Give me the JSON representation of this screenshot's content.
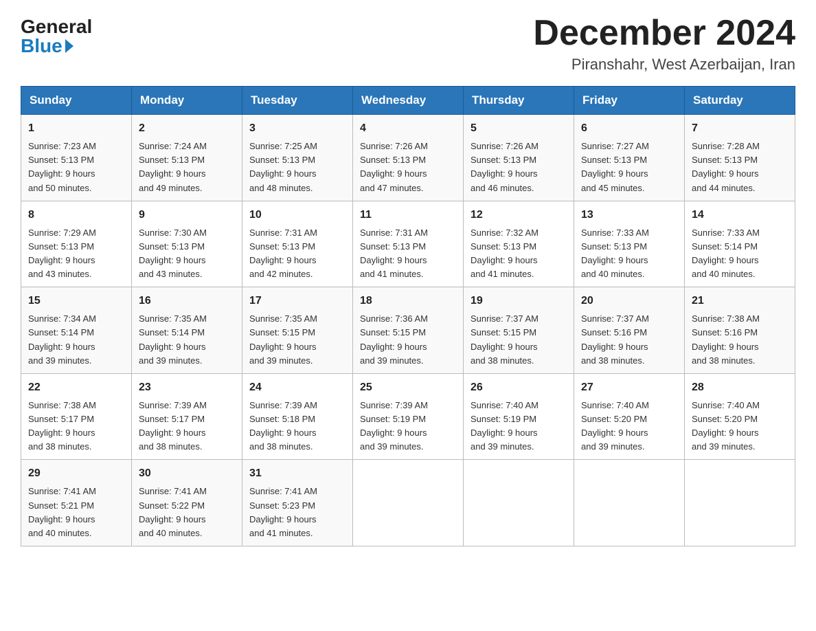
{
  "header": {
    "logo_general": "General",
    "logo_blue": "Blue",
    "month_title": "December 2024",
    "location": "Piranshahr, West Azerbaijan, Iran"
  },
  "weekdays": [
    "Sunday",
    "Monday",
    "Tuesday",
    "Wednesday",
    "Thursday",
    "Friday",
    "Saturday"
  ],
  "weeks": [
    [
      {
        "day": "1",
        "sunrise": "7:23 AM",
        "sunset": "5:13 PM",
        "daylight": "9 hours and 50 minutes."
      },
      {
        "day": "2",
        "sunrise": "7:24 AM",
        "sunset": "5:13 PM",
        "daylight": "9 hours and 49 minutes."
      },
      {
        "day": "3",
        "sunrise": "7:25 AM",
        "sunset": "5:13 PM",
        "daylight": "9 hours and 48 minutes."
      },
      {
        "day": "4",
        "sunrise": "7:26 AM",
        "sunset": "5:13 PM",
        "daylight": "9 hours and 47 minutes."
      },
      {
        "day": "5",
        "sunrise": "7:26 AM",
        "sunset": "5:13 PM",
        "daylight": "9 hours and 46 minutes."
      },
      {
        "day": "6",
        "sunrise": "7:27 AM",
        "sunset": "5:13 PM",
        "daylight": "9 hours and 45 minutes."
      },
      {
        "day": "7",
        "sunrise": "7:28 AM",
        "sunset": "5:13 PM",
        "daylight": "9 hours and 44 minutes."
      }
    ],
    [
      {
        "day": "8",
        "sunrise": "7:29 AM",
        "sunset": "5:13 PM",
        "daylight": "9 hours and 43 minutes."
      },
      {
        "day": "9",
        "sunrise": "7:30 AM",
        "sunset": "5:13 PM",
        "daylight": "9 hours and 43 minutes."
      },
      {
        "day": "10",
        "sunrise": "7:31 AM",
        "sunset": "5:13 PM",
        "daylight": "9 hours and 42 minutes."
      },
      {
        "day": "11",
        "sunrise": "7:31 AM",
        "sunset": "5:13 PM",
        "daylight": "9 hours and 41 minutes."
      },
      {
        "day": "12",
        "sunrise": "7:32 AM",
        "sunset": "5:13 PM",
        "daylight": "9 hours and 41 minutes."
      },
      {
        "day": "13",
        "sunrise": "7:33 AM",
        "sunset": "5:13 PM",
        "daylight": "9 hours and 40 minutes."
      },
      {
        "day": "14",
        "sunrise": "7:33 AM",
        "sunset": "5:14 PM",
        "daylight": "9 hours and 40 minutes."
      }
    ],
    [
      {
        "day": "15",
        "sunrise": "7:34 AM",
        "sunset": "5:14 PM",
        "daylight": "9 hours and 39 minutes."
      },
      {
        "day": "16",
        "sunrise": "7:35 AM",
        "sunset": "5:14 PM",
        "daylight": "9 hours and 39 minutes."
      },
      {
        "day": "17",
        "sunrise": "7:35 AM",
        "sunset": "5:15 PM",
        "daylight": "9 hours and 39 minutes."
      },
      {
        "day": "18",
        "sunrise": "7:36 AM",
        "sunset": "5:15 PM",
        "daylight": "9 hours and 39 minutes."
      },
      {
        "day": "19",
        "sunrise": "7:37 AM",
        "sunset": "5:15 PM",
        "daylight": "9 hours and 38 minutes."
      },
      {
        "day": "20",
        "sunrise": "7:37 AM",
        "sunset": "5:16 PM",
        "daylight": "9 hours and 38 minutes."
      },
      {
        "day": "21",
        "sunrise": "7:38 AM",
        "sunset": "5:16 PM",
        "daylight": "9 hours and 38 minutes."
      }
    ],
    [
      {
        "day": "22",
        "sunrise": "7:38 AM",
        "sunset": "5:17 PM",
        "daylight": "9 hours and 38 minutes."
      },
      {
        "day": "23",
        "sunrise": "7:39 AM",
        "sunset": "5:17 PM",
        "daylight": "9 hours and 38 minutes."
      },
      {
        "day": "24",
        "sunrise": "7:39 AM",
        "sunset": "5:18 PM",
        "daylight": "9 hours and 38 minutes."
      },
      {
        "day": "25",
        "sunrise": "7:39 AM",
        "sunset": "5:19 PM",
        "daylight": "9 hours and 39 minutes."
      },
      {
        "day": "26",
        "sunrise": "7:40 AM",
        "sunset": "5:19 PM",
        "daylight": "9 hours and 39 minutes."
      },
      {
        "day": "27",
        "sunrise": "7:40 AM",
        "sunset": "5:20 PM",
        "daylight": "9 hours and 39 minutes."
      },
      {
        "day": "28",
        "sunrise": "7:40 AM",
        "sunset": "5:20 PM",
        "daylight": "9 hours and 39 minutes."
      }
    ],
    [
      {
        "day": "29",
        "sunrise": "7:41 AM",
        "sunset": "5:21 PM",
        "daylight": "9 hours and 40 minutes."
      },
      {
        "day": "30",
        "sunrise": "7:41 AM",
        "sunset": "5:22 PM",
        "daylight": "9 hours and 40 minutes."
      },
      {
        "day": "31",
        "sunrise": "7:41 AM",
        "sunset": "5:23 PM",
        "daylight": "9 hours and 41 minutes."
      },
      null,
      null,
      null,
      null
    ]
  ],
  "labels": {
    "sunrise": "Sunrise:",
    "sunset": "Sunset:",
    "daylight": "Daylight:"
  }
}
